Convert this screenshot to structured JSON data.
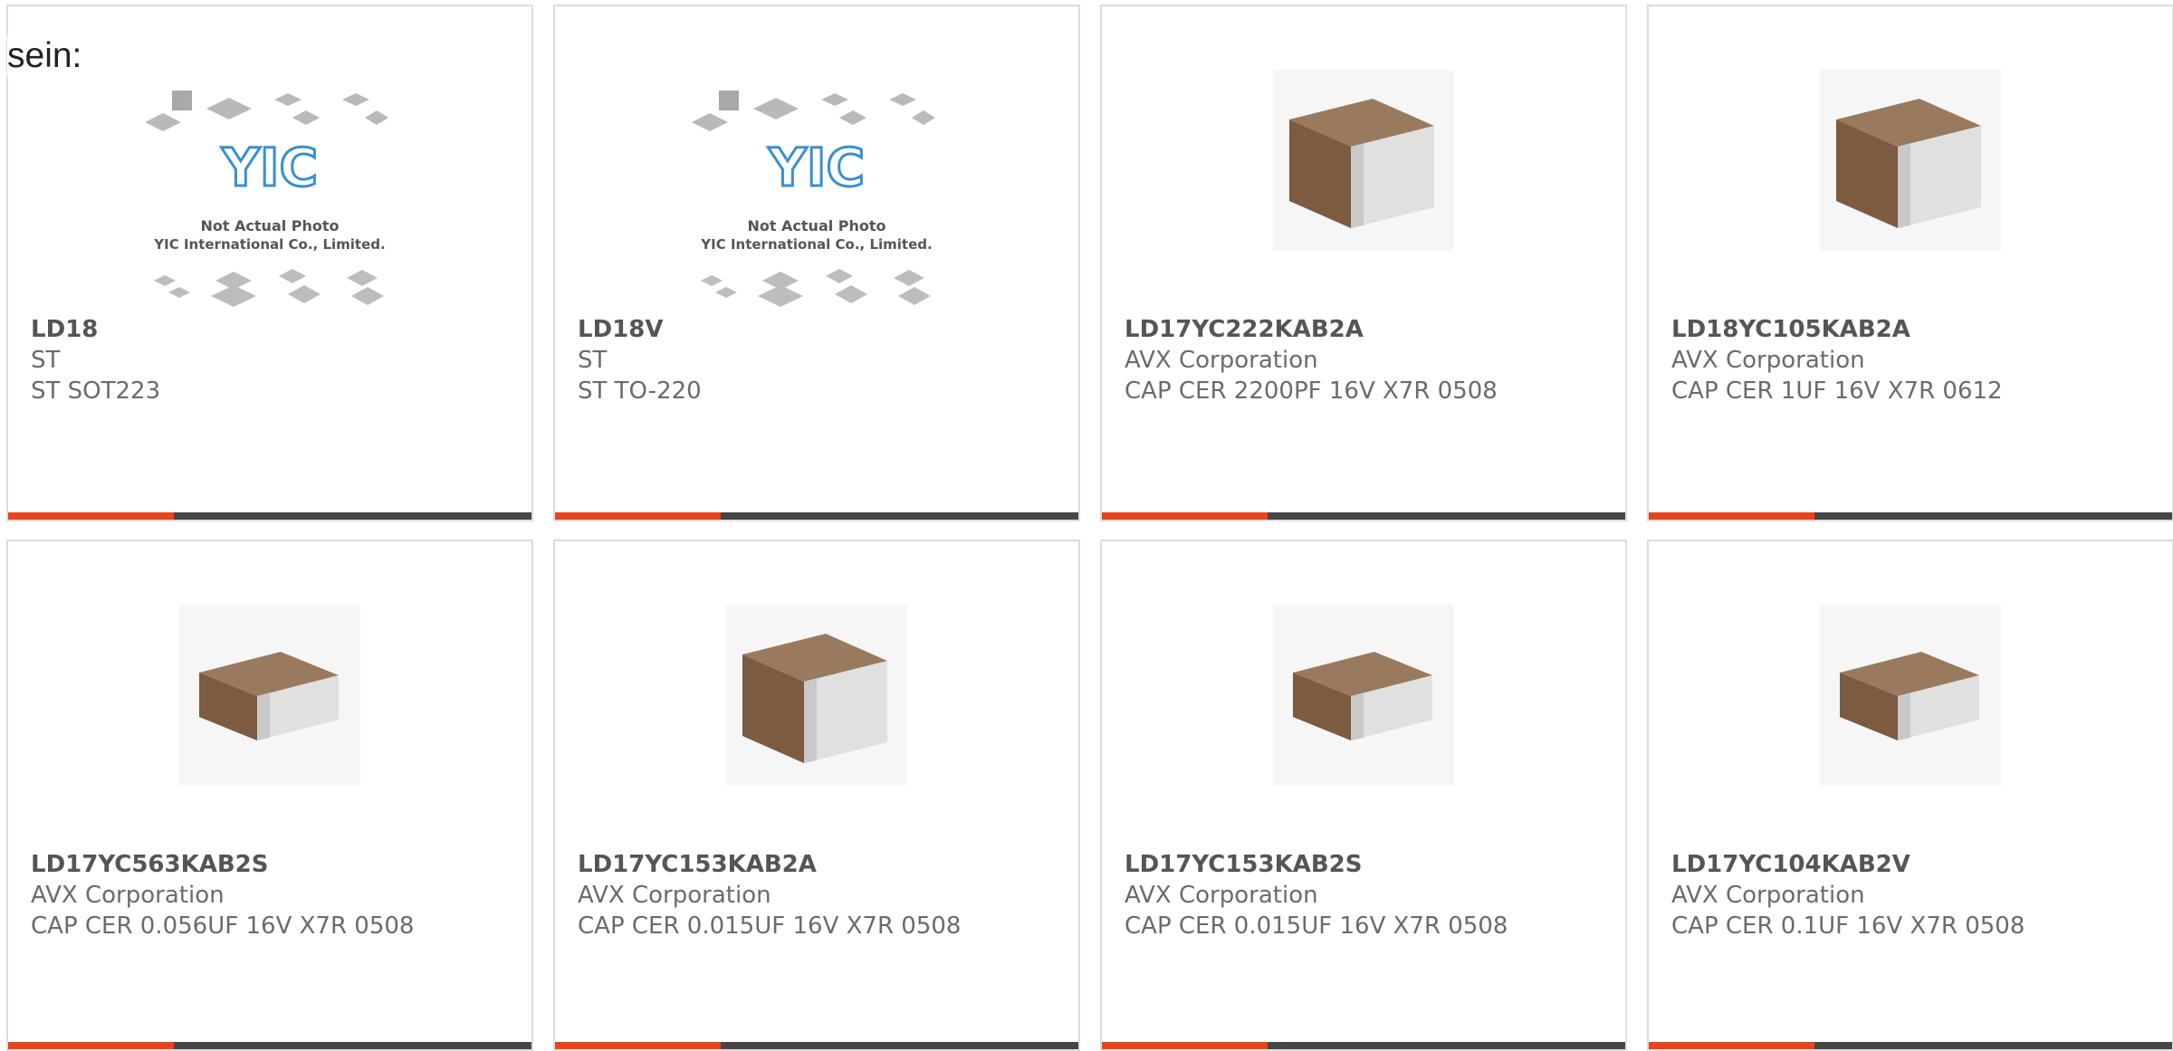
{
  "intro_text": "sein:",
  "colors": {
    "accent": "#e8441c",
    "bar": "#464646",
    "card_border": "#dcdcdc"
  },
  "products": [
    {
      "part_number": "LD18",
      "manufacturer": "ST",
      "description": "ST SOT223",
      "image": "not-actual-photo",
      "photo_note_1": "Not Actual Photo",
      "photo_note_2": "YIC International Co., Limited.",
      "logo_text": "YIC"
    },
    {
      "part_number": "LD18V",
      "manufacturer": "ST",
      "description": "ST TO-220",
      "image": "not-actual-photo",
      "photo_note_1": "Not Actual Photo",
      "photo_note_2": "YIC International Co., Limited.",
      "logo_text": "YIC"
    },
    {
      "part_number": "LD17YC222KAB2A",
      "manufacturer": "AVX Corporation",
      "description": "CAP CER 2200PF 16V X7R 0508",
      "image": "capacitor-photo"
    },
    {
      "part_number": "LD18YC105KAB2A",
      "manufacturer": "AVX Corporation",
      "description": "CAP CER 1UF 16V X7R 0612",
      "image": "capacitor-photo"
    },
    {
      "part_number": "LD17YC563KAB2S",
      "manufacturer": "AVX Corporation",
      "description": "CAP CER 0.056UF 16V X7R 0508",
      "image": "capacitor-photo"
    },
    {
      "part_number": "LD17YC153KAB2A",
      "manufacturer": "AVX Corporation",
      "description": "CAP CER 0.015UF 16V X7R 0508",
      "image": "capacitor-photo"
    },
    {
      "part_number": "LD17YC153KAB2S",
      "manufacturer": "AVX Corporation",
      "description": "CAP CER 0.015UF 16V X7R 0508",
      "image": "capacitor-photo"
    },
    {
      "part_number": "LD17YC104KAB2V",
      "manufacturer": "AVX Corporation",
      "description": "CAP CER 0.1UF 16V X7R 0508",
      "image": "capacitor-photo"
    }
  ]
}
